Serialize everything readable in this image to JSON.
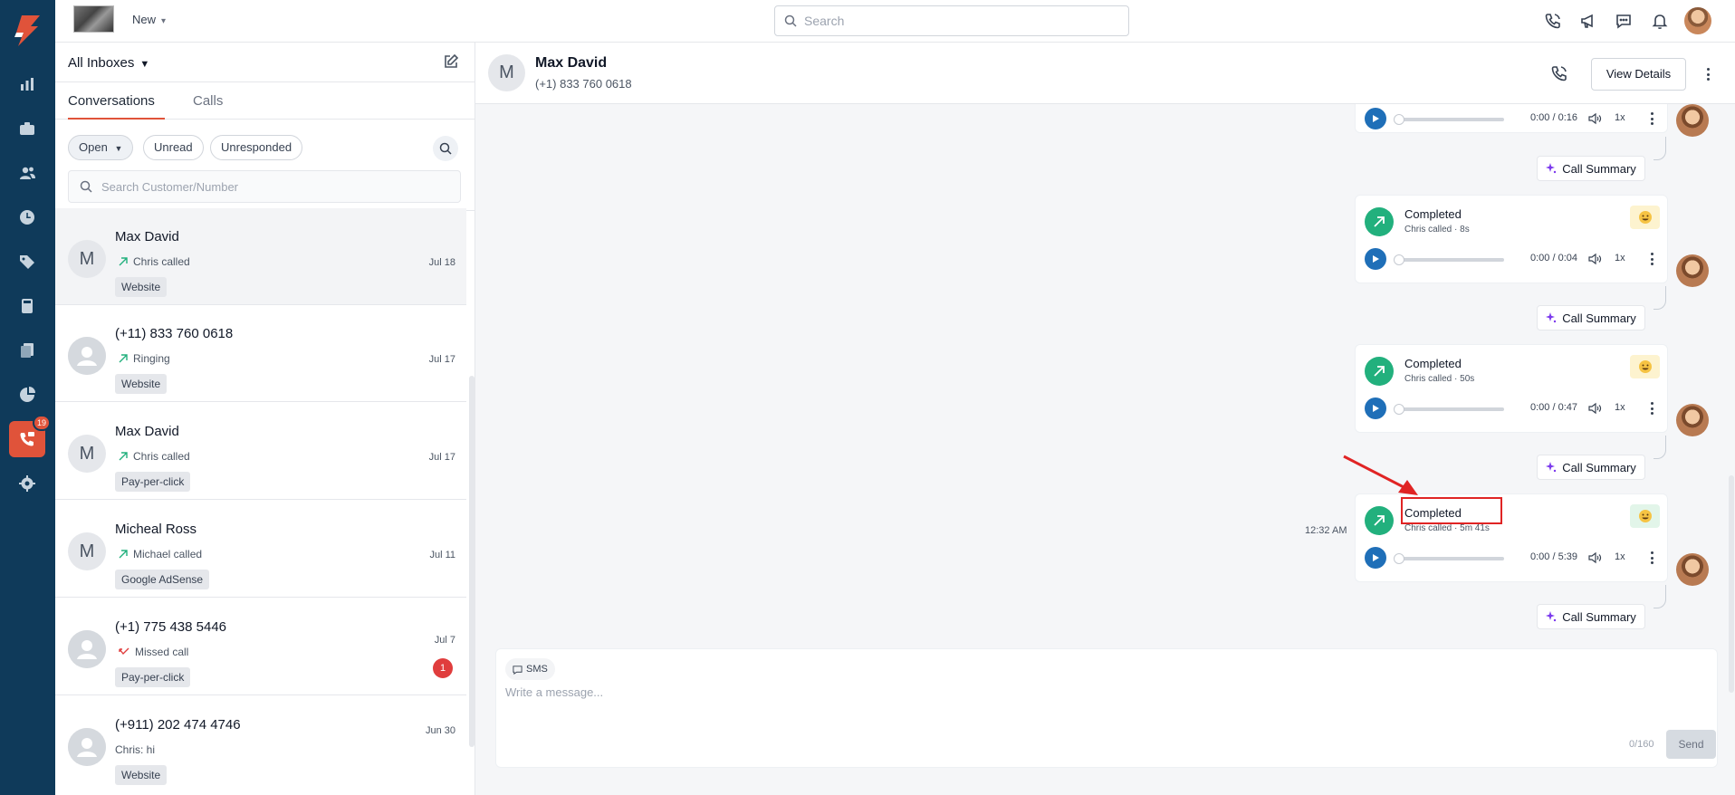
{
  "rail": {
    "badge_count": "19",
    "items": [
      "reports-icon",
      "briefcase-icon",
      "contacts-icon",
      "history-icon",
      "tag-icon",
      "calculator-icon",
      "documents-icon",
      "analytics-icon",
      "phone-chat-icon",
      "settings-icon"
    ],
    "active_item": "phone-chat-icon"
  },
  "topbar": {
    "new_label": "New",
    "search_placeholder": "Search"
  },
  "list": {
    "inbox_label": "All Inboxes",
    "tabs": [
      {
        "label": "Conversations"
      },
      {
        "label": "Calls"
      }
    ],
    "filters": [
      {
        "label": "Open"
      },
      {
        "label": "Unread"
      },
      {
        "label": "Unresponded"
      }
    ],
    "search_placeholder": "Search Customer/Number",
    "conversations": [
      {
        "avatar": "M",
        "name": "Max David",
        "status": "Chris called",
        "tag": "Website",
        "date": "Jul 18"
      },
      {
        "avatar": "",
        "name": "(+11) 833 760 0618",
        "status": "Ringing",
        "tag": "Website",
        "date": "Jul 17"
      },
      {
        "avatar": "M",
        "name": "Max David",
        "status": "Chris called",
        "tag": "Pay-per-click",
        "date": "Jul 17"
      },
      {
        "avatar": "M",
        "name": "Micheal Ross",
        "status": "Michael called",
        "tag": "Google AdSense",
        "date": "Jul 11"
      },
      {
        "avatar": "",
        "name": "(+1) 775 438 5446",
        "status": "Missed call",
        "tag": "Pay-per-click",
        "date": "Jul 7",
        "unread": "1"
      },
      {
        "avatar": "",
        "name": "(+911) 202 474 4746",
        "status": "Chris: hi",
        "tag": "Website",
        "date": "Jun 30"
      }
    ]
  },
  "chat": {
    "avatar": "M",
    "name": "Max David",
    "phone": "(+1) 833 760 0618",
    "view_details_label": "View Details",
    "calls": [
      {
        "title": "",
        "sub": "",
        "time": "0:00 / 0:16",
        "speed": "1x"
      },
      {
        "title": "Completed",
        "sub": "Chris called · 8s",
        "time": "0:00 / 0:04",
        "speed": "1x"
      },
      {
        "title": "Completed",
        "sub": "Chris called · 50s",
        "time": "0:00 / 0:47",
        "speed": "1x"
      },
      {
        "title": "Completed",
        "sub": "Chris called · 5m 41s",
        "time": "0:00 / 5:39",
        "speed": "1x",
        "timestamp": "12:32 AM"
      }
    ],
    "call_summary_label": "Call Summary",
    "composer": {
      "channel": "SMS",
      "placeholder": "Write a message...",
      "counter": "0/160",
      "send_label": "Send"
    }
  },
  "colors": {
    "rail": "#0f3a5a",
    "accent": "#e0533a",
    "call_completed": "#22b07d",
    "play": "#1f6fb8",
    "annotation": "#e02424"
  }
}
